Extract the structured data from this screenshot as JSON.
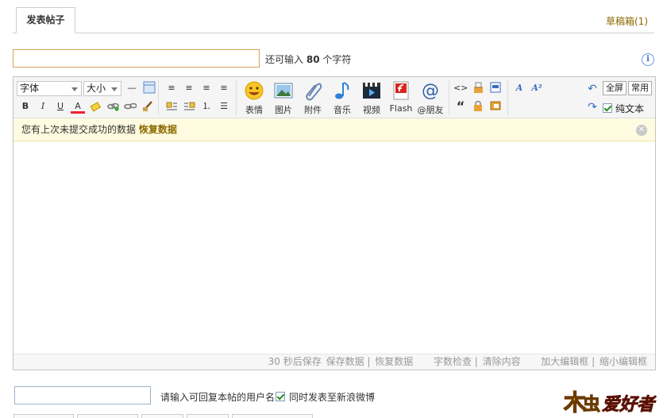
{
  "tabs": {
    "active": "发表帖子",
    "draft": "草稿箱(1)"
  },
  "title": {
    "value": "",
    "placeholder": "",
    "remain_prefix": "还可输入",
    "remain_count": "80",
    "remain_suffix": "个字符"
  },
  "toolbar": {
    "font_select": "字体",
    "size_select": "大小",
    "big_buttons": [
      "表情",
      "图片",
      "附件",
      "音乐",
      "视频",
      "Flash",
      "@朋友"
    ],
    "fullscreen": "全屏",
    "common": "常用",
    "plain_text": "纯文本"
  },
  "notice": {
    "text": "您有上次未提交成功的数据",
    "action": "恢复数据"
  },
  "status": {
    "autosave": "30 秒后保存",
    "save": "保存数据",
    "restore": "恢复数据",
    "check": "字数检查",
    "clear": "清除内容",
    "enlarge": "加大编辑框",
    "shrink": "缩小编辑框"
  },
  "reply": {
    "hint": "请输入可回复本帖的用户名",
    "weibo": "同时发表至新浪微博"
  },
  "logo": {
    "text": "木虫 爱好者"
  },
  "colors": {
    "accent": "#8b6a00",
    "notice_bg": "#fffbe0",
    "title_border": "#d5a35a"
  }
}
